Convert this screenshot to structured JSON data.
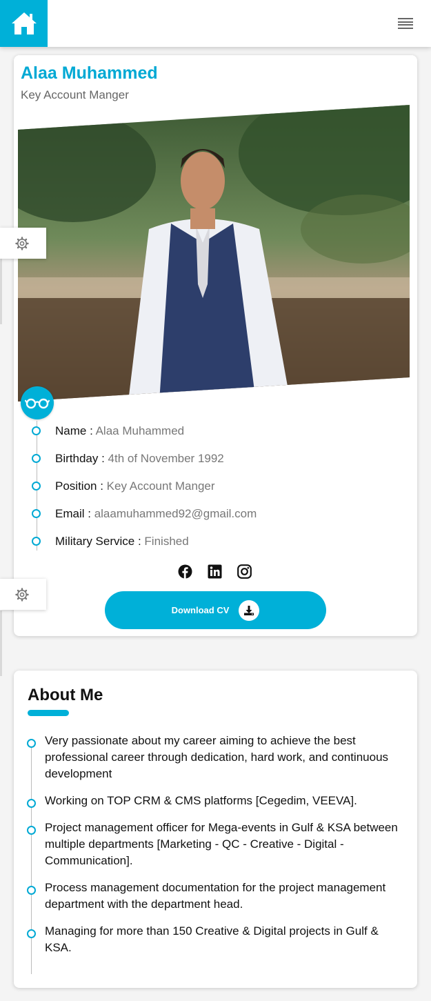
{
  "header": {
    "home_icon": "home-icon",
    "menu_icon": "hamburger-menu-icon",
    "accent_color": "#00b0d8"
  },
  "profile": {
    "name": "Alaa Muhammed",
    "role": "Key Account Manger",
    "badge_icon": "glasses-icon",
    "info": [
      {
        "label": "Name :",
        "value": "Alaa Muhammed"
      },
      {
        "label": "Birthday :",
        "value": "4th of November 1992"
      },
      {
        "label": "Position :",
        "value": "Key Account Manger"
      },
      {
        "label": "Email :",
        "value": "alaamuhammed92@gmail.com"
      },
      {
        "label": "Military Service :",
        "value": "Finished"
      }
    ],
    "social": [
      "facebook-icon",
      "linkedin-icon",
      "instagram-icon"
    ],
    "download_label": "Download CV"
  },
  "about": {
    "title": "About Me",
    "items": [
      "Very passionate about my career aiming to achieve the best professional career through dedication, hard work, and continuous development",
      "Working on TOP CRM & CMS platforms [Cegedim, VEEVA].",
      "Project management officer for Mega-events in Gulf & KSA between multiple departments [Marketing - QC - Creative - Digital - Communication].",
      "Process management documentation for the project management department with the department head.",
      "Managing for more than 150 Creative & Digital projects in Gulf & KSA."
    ]
  }
}
